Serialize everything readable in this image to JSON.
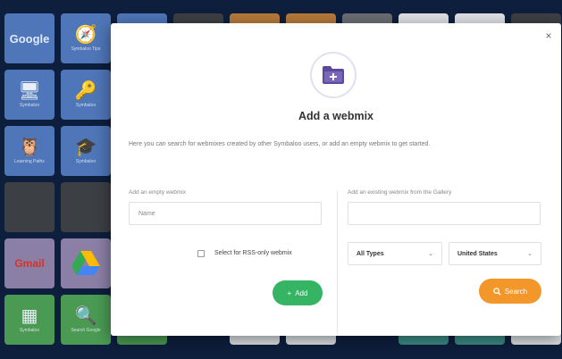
{
  "background_tiles": {
    "google_word": "Google",
    "gmail_word": "Gmail",
    "symbaloo_tips_caption": "Symbaloo Tips",
    "tile2_caption": "Symbaloo",
    "tile3_caption": "Symbaloo",
    "learning_paths_caption": "Learning Paths",
    "tile5_caption": "Symbaloo",
    "tile6_caption": "Symbaloo",
    "tile7_caption": "Search Google"
  },
  "modal": {
    "close_glyph": "×",
    "title": "Add a webmix",
    "description": "Here you can search for webmixes created by other Symbaloo users, or add an empty webmix to get started.",
    "left": {
      "label": "Add an empty webmix",
      "name_placeholder": "Name",
      "rss_checkbox_label": "Select for RSS-only webmix",
      "add_button": "Add",
      "add_icon": "+"
    },
    "right": {
      "label": "Add an existing webmix from the Gallery",
      "search_value": "",
      "types_select": "All Types",
      "region_select": "United States",
      "search_button": "Search",
      "search_icon": "magnifier"
    }
  },
  "colors": {
    "add_green": "#35b463",
    "search_orange": "#f4972b",
    "folder_purple": "#5b4a9b"
  }
}
